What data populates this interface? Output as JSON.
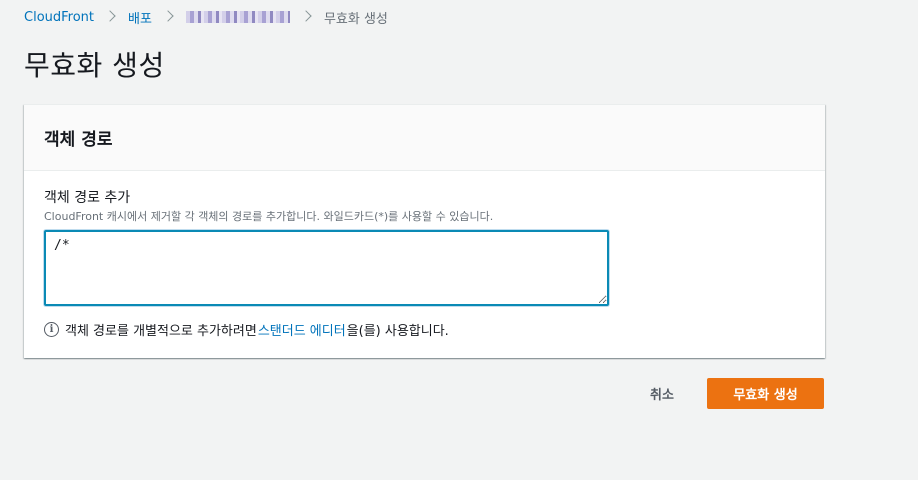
{
  "breadcrumb": {
    "items": [
      {
        "label": "CloudFront"
      },
      {
        "label": "배포"
      },
      {
        "label": ""
      },
      {
        "label": "무효화 생성"
      }
    ]
  },
  "page": {
    "title": "무효화 생성"
  },
  "panel": {
    "title": "객체 경로",
    "field_label": "객체 경로 추가",
    "field_description": "CloudFront 캐시에서 제거할 각 객체의 경로를 추가합니다. 와일드카드(*)를 사용할 수 있습니다.",
    "paths_value": "/*",
    "info_prefix": "객체 경로를 개별적으로 추가하려면 ",
    "info_link": "스탠더드 에디터",
    "info_suffix": "을(를) 사용합니다."
  },
  "actions": {
    "cancel_label": "취소",
    "create_label": "무효화 생성"
  },
  "colors": {
    "primary_button": "#ec7211",
    "link": "#0073bb",
    "focus_border": "#0a8ab5"
  }
}
